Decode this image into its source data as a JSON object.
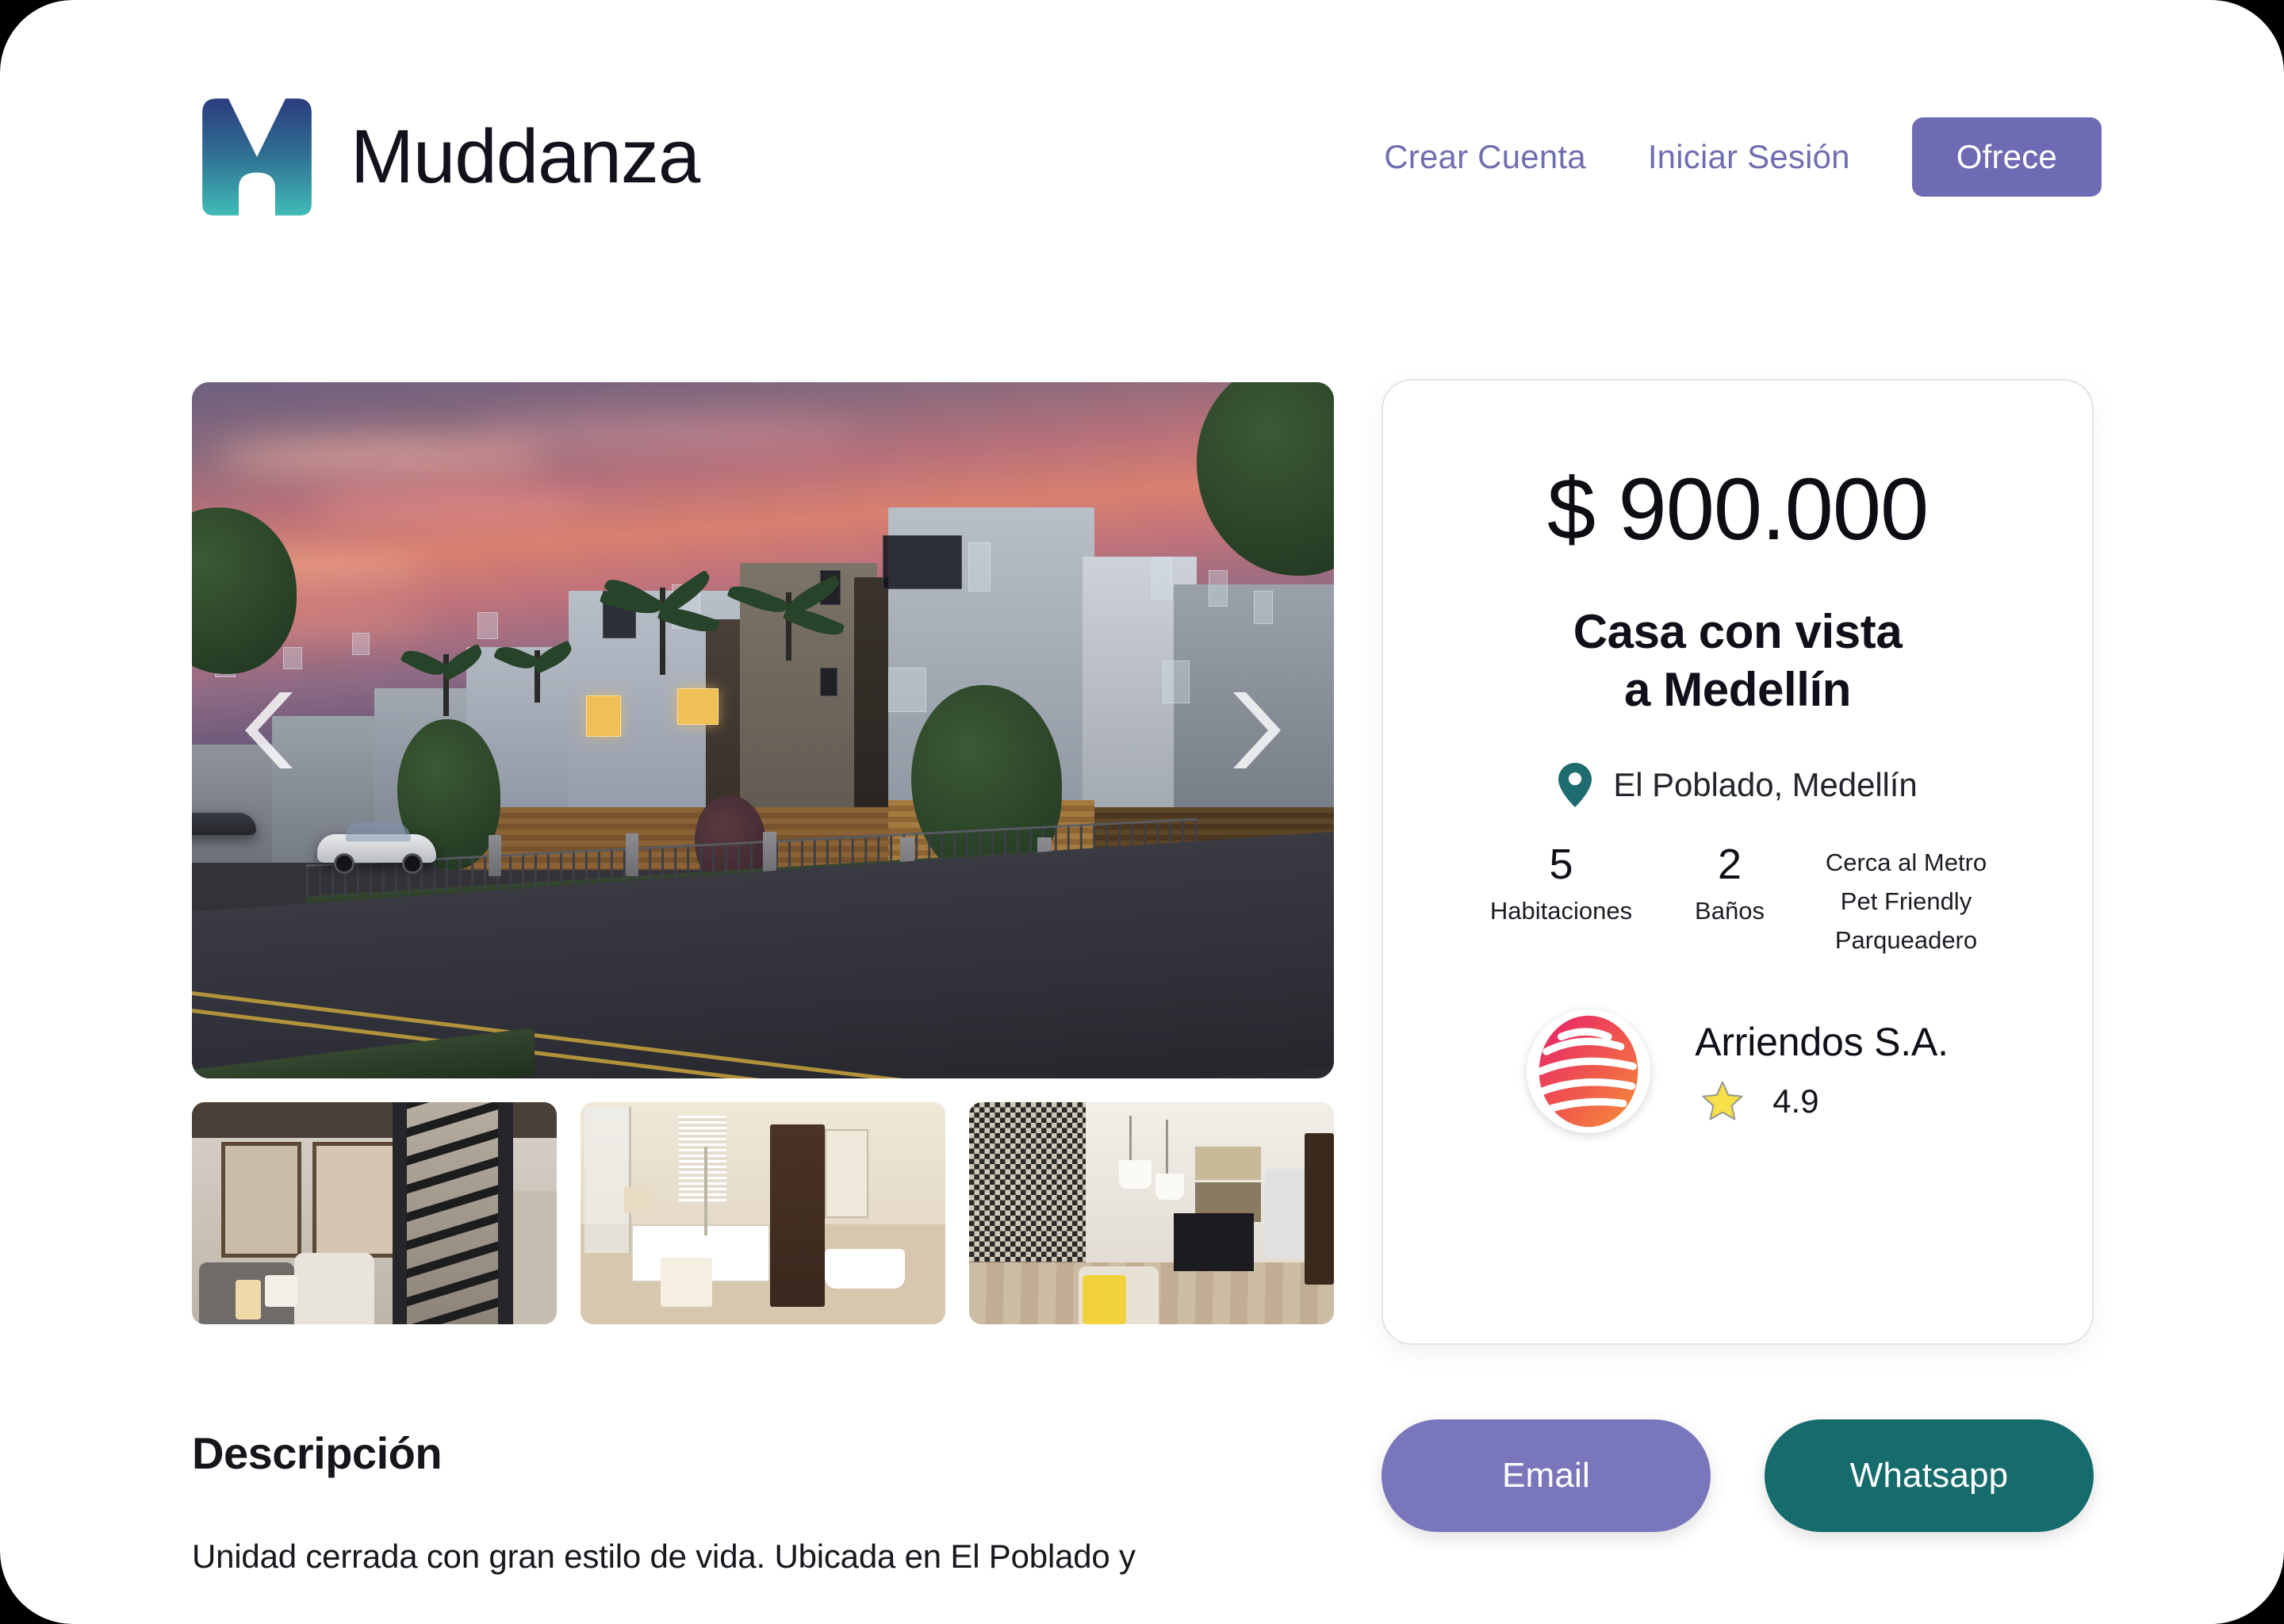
{
  "brand": {
    "name": "Muddanza",
    "logo_icon": "muddanza-m-logo",
    "logo_gradient_from": "#2b3c7e",
    "logo_gradient_to": "#3fb9b8"
  },
  "nav": {
    "links": [
      {
        "label": "Crear Cuenta",
        "name": "nav-link-crear-cuenta"
      },
      {
        "label": "Iniciar Sesión",
        "name": "nav-link-iniciar-sesion"
      }
    ],
    "cta_label": "Ofrece",
    "link_color": "#716eb0",
    "cta_color": "#6e6bb4"
  },
  "gallery": {
    "prev_label": "‹",
    "next_label": "›",
    "hero_alt": "Conjunto de casas modernas al atardecer",
    "thumbnails": [
      {
        "alt": "Sala con escalera metálica"
      },
      {
        "alt": "Baño con bañera y mueble oscuro"
      },
      {
        "alt": "Cocina y comedor con pared decorada"
      }
    ]
  },
  "listing": {
    "price": "$ 900.000",
    "title_line_1": "Casa con vista",
    "title_line_2": "a Medellín",
    "location": "El Poblado, Medellín",
    "location_icon": "map-pin-icon",
    "location_icon_color": "#1e6b70",
    "stats": [
      {
        "value": "5",
        "label": "Habitaciones"
      },
      {
        "value": "2",
        "label": "Baños"
      }
    ],
    "amenities": [
      "Cerca al Metro",
      "Pet Friendly",
      "Parqueadero"
    ]
  },
  "agency": {
    "name": "Arriendos S.A.",
    "rating": "4.9",
    "star_icon": "⭐",
    "avatar_icon": "globe-sphere-avatar",
    "avatar_gradient_from": "#e8306f",
    "avatar_gradient_to": "#f2803c"
  },
  "actions": {
    "email_label": "Email",
    "whatsapp_label": "Whatsapp",
    "email_color": "#7a76bb",
    "whatsapp_color": "#166b6d"
  },
  "description": {
    "heading": "Descripción",
    "body": "Unidad cerrada con gran estilo de vida. Ubicada en El Poblado y"
  }
}
